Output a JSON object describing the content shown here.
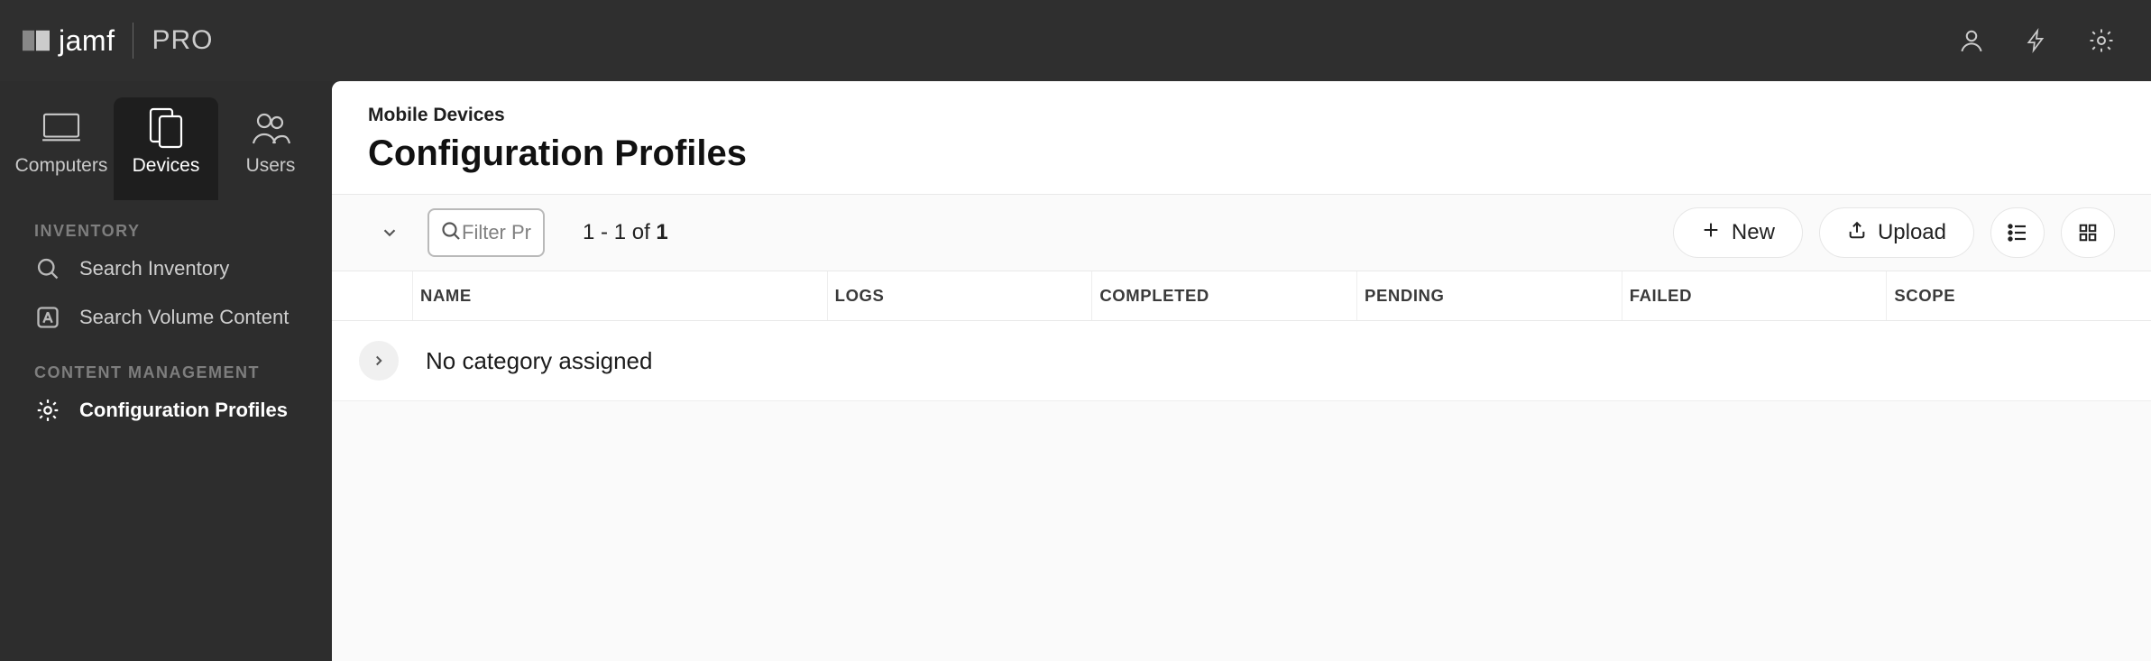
{
  "brand": {
    "name": "jamf",
    "variant": "PRO"
  },
  "topbar_icons": [
    "user-icon",
    "bolt-icon",
    "gear-icon"
  ],
  "nav_tabs": [
    {
      "key": "computers",
      "label": "Computers"
    },
    {
      "key": "devices",
      "label": "Devices"
    },
    {
      "key": "users",
      "label": "Users"
    }
  ],
  "active_nav_tab": "devices",
  "side_sections": [
    {
      "title": "INVENTORY",
      "items": [
        {
          "key": "search-inventory",
          "label": "Search Inventory"
        },
        {
          "key": "search-volume-content",
          "label": "Search Volume Content"
        }
      ]
    },
    {
      "title": "CONTENT MANAGEMENT",
      "items": [
        {
          "key": "configuration-profiles",
          "label": "Configuration Profiles",
          "active": true
        }
      ]
    }
  ],
  "breadcrumb": "Mobile Devices",
  "page_title": "Configuration Profiles",
  "filter": {
    "placeholder": "Filter Pr"
  },
  "result_count": {
    "from": 1,
    "to": 1,
    "total": 1,
    "template_prefix": " - ",
    "of_word": " of "
  },
  "actions": {
    "new": "New",
    "upload": "Upload"
  },
  "columns": [
    "NAME",
    "LOGS",
    "COMPLETED",
    "PENDING",
    "FAILED",
    "SCOPE"
  ],
  "categories": [
    {
      "name": "No category assigned"
    }
  ]
}
